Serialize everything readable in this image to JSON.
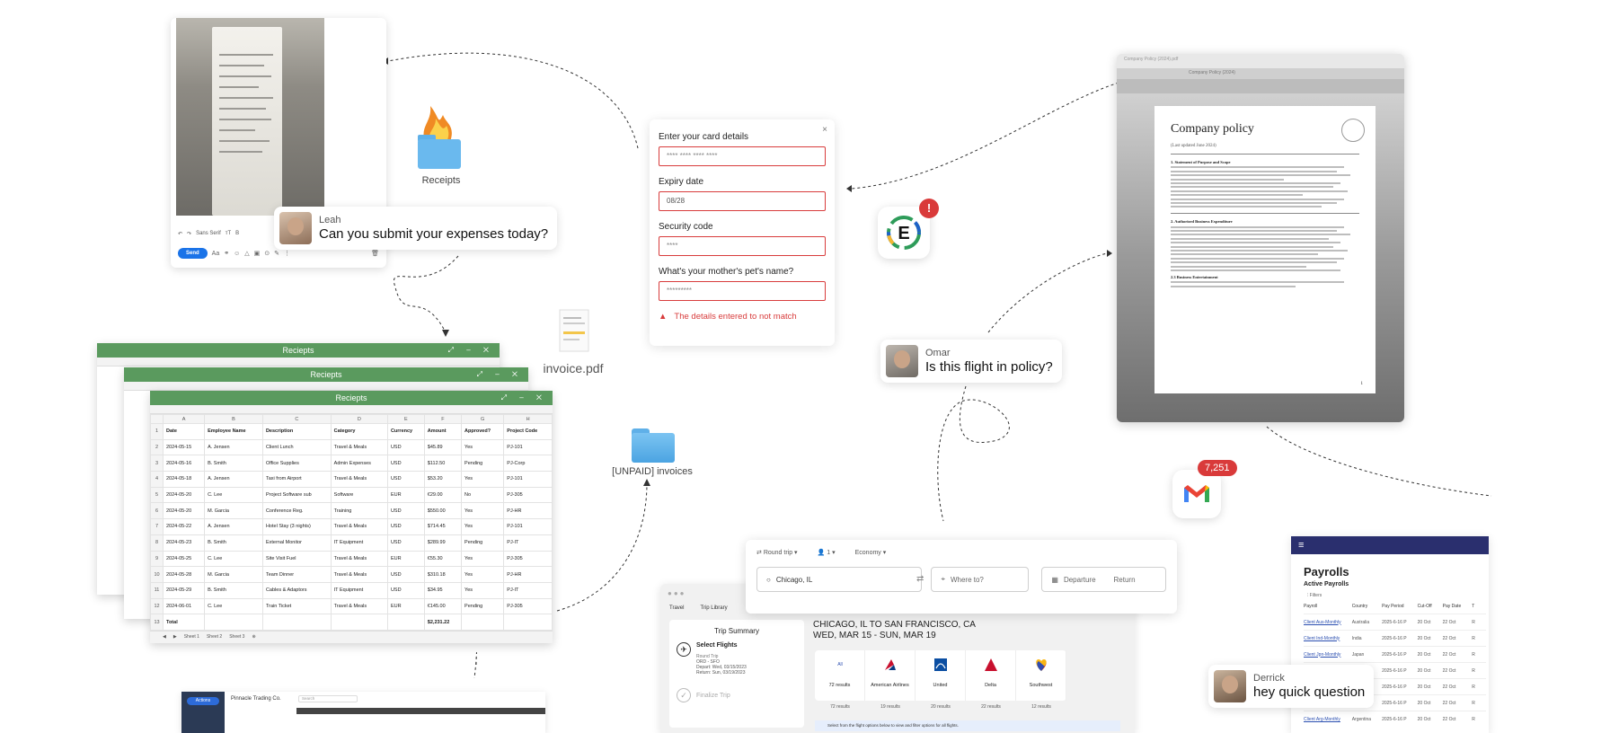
{
  "composer": {
    "font_label": "Sans Serif",
    "send_label": "Send"
  },
  "leah": {
    "name": "Leah",
    "message": "Can you submit your expenses today?"
  },
  "omar": {
    "name": "Omar",
    "message": "Is this flight in policy?"
  },
  "derrick": {
    "name": "Derrick",
    "message": "hey quick question"
  },
  "receipts_folder": {
    "label": "Receipts",
    "icon": "burning-folder-icon"
  },
  "invoice_file": {
    "label": "invoice.pdf",
    "icon": "pdf-file-icon"
  },
  "unpaid_folder": {
    "label": "[UNPAID] invoices",
    "icon": "folder-icon"
  },
  "card_form": {
    "title": "Enter your card details",
    "card_value": "**** **** **** ****",
    "expiry_label": "Expiry date",
    "expiry_value": "08/28",
    "security_label": "Security code",
    "security_value": "****",
    "question_label": "What's your mother's pet's name?",
    "question_value": "*********",
    "error": "The details entered to not match",
    "close": "×"
  },
  "expensify": {
    "letter": "E",
    "badge": "!"
  },
  "gmail": {
    "badge": "7,251"
  },
  "spreadsheet": {
    "title": "Reciepts",
    "columns": [
      "A",
      "B",
      "C",
      "D",
      "E",
      "F",
      "G",
      "H"
    ],
    "headers": [
      "Date",
      "Employee Name",
      "Description",
      "Category",
      "Currency",
      "Amount",
      "Approved?",
      "Project Code"
    ],
    "rows": [
      [
        "2024-05-15",
        "A. Jensen",
        "Client Lunch",
        "Travel & Meals",
        "USD",
        "$45.89",
        "Yes",
        "PJ-101"
      ],
      [
        "2024-05-16",
        "B. Smith",
        "Office Supplies",
        "Admin Expenses",
        "USD",
        "$112.50",
        "Pending",
        "PJ-Corp"
      ],
      [
        "2024-05-18",
        "A. Jensen",
        "Taxi from Airport",
        "Travel & Meals",
        "USD",
        "$53.20",
        "Yes",
        "PJ-101"
      ],
      [
        "2024-05-20",
        "C. Lee",
        "Project Software sub",
        "Software",
        "EUR",
        "€29.00",
        "No",
        "PJ-305"
      ],
      [
        "2024-05-20",
        "M. Garcia",
        "Conference Reg.",
        "Training",
        "USD",
        "$550.00",
        "Yes",
        "PJ-HR"
      ],
      [
        "2024-05-22",
        "A. Jensen",
        "Hotel Stay (3 nights)",
        "Travel & Meals",
        "USD",
        "$714.45",
        "Yes",
        "PJ-101"
      ],
      [
        "2024-05-23",
        "B. Smith",
        "External Monitor",
        "IT Equipment",
        "USD",
        "$289.99",
        "Pending",
        "PJ-IT"
      ],
      [
        "2024-05-25",
        "C. Lee",
        "Site Visit Fuel",
        "Travel & Meals",
        "EUR",
        "€55.30",
        "Yes",
        "PJ-305"
      ],
      [
        "2024-05-28",
        "M. Garcia",
        "Team Dinner",
        "Travel & Meals",
        "USD",
        "$310.18",
        "Yes",
        "PJ-HR"
      ],
      [
        "2024-05-29",
        "B. Smith",
        "Cables & Adaptors",
        "IT Equipment",
        "USD",
        "$34.95",
        "Yes",
        "PJ-IT"
      ],
      [
        "2024-06-01",
        "C. Lee",
        "Train Ticket",
        "Travel & Meals",
        "EUR",
        "€145.00",
        "Pending",
        "PJ-305"
      ]
    ],
    "total_label": "Total",
    "total_value": "$2,231.22",
    "tabs": [
      "Sheet 1",
      "Sheet 2",
      "Sheet 3"
    ]
  },
  "policy_doc": {
    "window_title": "Company Policy (2024).pdf",
    "tab_title": "Company Policy (2024)",
    "title": "Company policy",
    "updated": "(Last updated June 2024)",
    "sections": [
      "1. Statement of Purpose and Scope",
      "2. Authorized Business Expenditure",
      "2.3 Business Entertainment"
    ],
    "page_number": "1"
  },
  "flight_search": {
    "trip_type": "Round trip",
    "passengers": "1",
    "cabin": "Economy",
    "origin": "Chicago, IL",
    "destination_placeholder": "Where to?",
    "departure_placeholder": "Departure",
    "return_placeholder": "Return"
  },
  "trip_window": {
    "tabs": [
      "Travel",
      "Trip Library"
    ],
    "summary_title": "Trip Summary",
    "step1": "Select Flights",
    "trip_kind": "Round Trip",
    "route_code": "ORD - SFO",
    "depart": "Depart: Wed, 03/15/2023",
    "return": "Return: Sun, 03/19/2023",
    "step2": "Finalize Trip",
    "route_title": "CHICAGO, IL TO SAN FRANCISCO, CA",
    "dates": "WED, MAR 15 - SUN, MAR 19",
    "airlines": [
      "American Airlines",
      "United",
      "Delta",
      "Southwest"
    ],
    "all_label": "All",
    "results": [
      "72 results",
      "19 results",
      "20 results",
      "22 results",
      "12 results"
    ],
    "notice": "Select from the flight options below to view and filter options for all flights."
  },
  "payroll": {
    "title": "Payrolls",
    "subtitle": "Active Payrolls",
    "filters": "Filters",
    "columns": [
      "Payroll",
      "Country",
      "Pay Period",
      "Cut-Off",
      "Pay Date",
      "T"
    ],
    "rows": [
      [
        "Client Aus-Monthly",
        "Australia",
        "2025-6-16 P",
        "20 Oct",
        "22 Oct",
        "R"
      ],
      [
        "Client Ind-Monthly",
        "India",
        "2025-6-16 P",
        "20 Oct",
        "22 Oct",
        "R"
      ],
      [
        "Client Jpn-Monthly",
        "Japan",
        "2025-6-16 P",
        "20 Oct",
        "22 Oct",
        "R"
      ],
      [
        "",
        "",
        "2025-6-16 P",
        "20 Oct",
        "22 Oct",
        "R"
      ],
      [
        "",
        "",
        "2025-6-16 P",
        "20 Oct",
        "22 Oct",
        "R"
      ],
      [
        "",
        "",
        "2025-6-16 P",
        "20 Oct",
        "22 Oct",
        "R"
      ],
      [
        "Client Arg-Monthly",
        "Argentina",
        "2025-6-16 P",
        "20 Oct",
        "22 Oct",
        "R"
      ]
    ]
  },
  "trading": {
    "company": "Pinnacle Trading Co.",
    "search_placeholder": "Search",
    "button": "Actions"
  }
}
